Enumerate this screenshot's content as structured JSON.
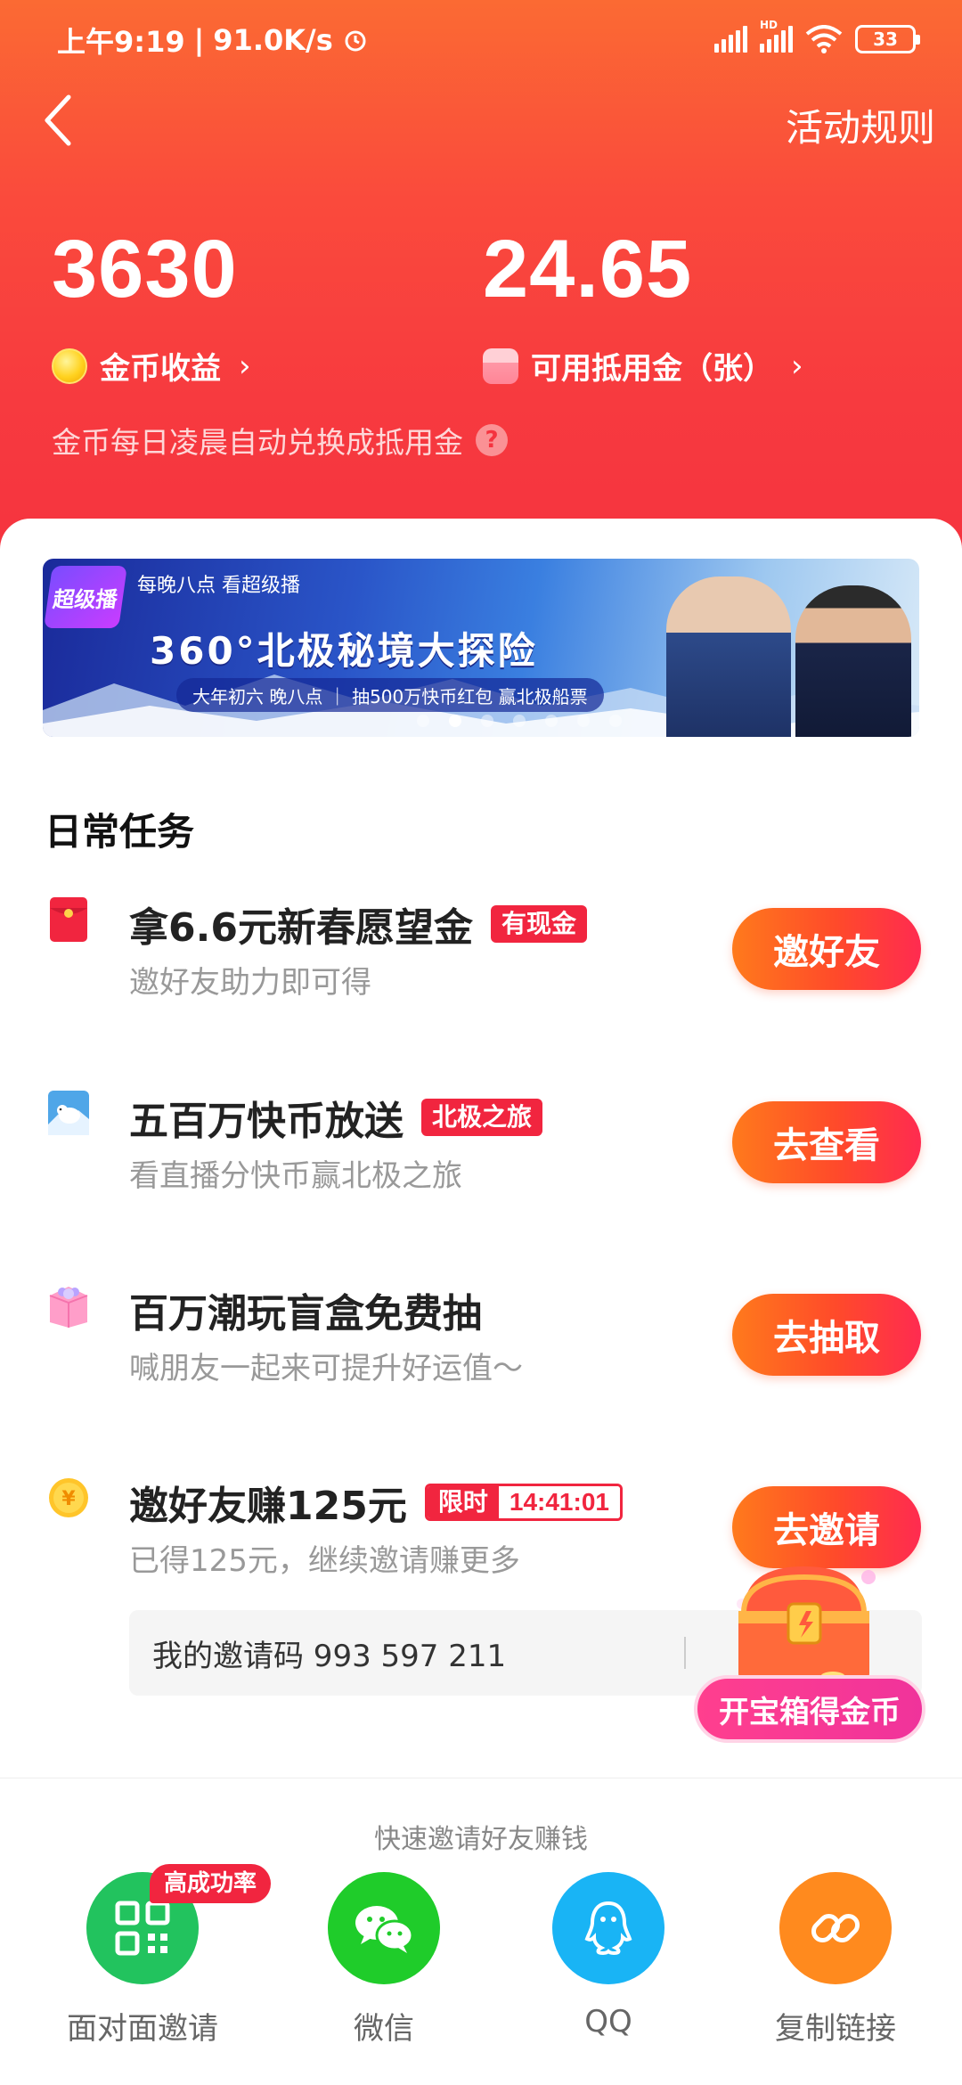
{
  "status_bar": {
    "time": "上午9:19",
    "speed": "91.0K/s",
    "hd_label": "HD",
    "battery": "33"
  },
  "nav": {
    "rules_label": "活动规则"
  },
  "stats": {
    "coins_value": "3630",
    "coins_label": "金币收益",
    "voucher_value": "24.65",
    "voucher_label": "可用抵用金（张）",
    "hint": "金币每日凌晨自动兑换成抵用金",
    "help_icon_text": "?"
  },
  "banner": {
    "logo_text": "超级播",
    "tag": "每晚八点 看超级播",
    "title": "360°北极秘境大探险",
    "subtitle": "大年初六 晚八点 ｜ 抽500万快币红包 赢北极船票",
    "dot_count": 7,
    "active_dot": 1
  },
  "section": {
    "title": "日常任务"
  },
  "tasks": [
    {
      "title": "拿6.6元新春愿望金",
      "tag": "有现金",
      "subtitle": "邀好友助力即可得",
      "button": "邀好友",
      "icon": "red-envelope-icon"
    },
    {
      "title": "五百万快币放送",
      "tag": "北极之旅",
      "subtitle": "看直播分快币赢北极之旅",
      "button": "去查看",
      "icon": "polar-bear-icon"
    },
    {
      "title": "百万潮玩盲盒免费抽",
      "tag": "",
      "subtitle": "喊朋友一起来可提升好运值～",
      "button": "去抽取",
      "icon": "blind-box-icon"
    },
    {
      "title": "邀好友赚125元",
      "tag_left": "限时",
      "tag_right": "14:41:01",
      "subtitle": "已得125元，继续邀请赚更多",
      "button": "去邀请",
      "icon": "yuan-coin-icon"
    }
  ],
  "invite_code": {
    "label": "我的邀请码 993 597 211"
  },
  "chest": {
    "label": "开宝箱得金币"
  },
  "share_sheet": {
    "title": "快速邀请好友赚钱",
    "hot_badge": "高成功率",
    "items": [
      {
        "label": "面对面邀请",
        "icon": "qr-code-icon",
        "color": "#22c35e"
      },
      {
        "label": "微信",
        "icon": "wechat-icon",
        "color": "#1fcc2a"
      },
      {
        "label": "QQ",
        "icon": "qq-icon",
        "color": "#19b4f5"
      },
      {
        "label": "复制链接",
        "icon": "link-icon",
        "color": "#ff8a1e"
      }
    ]
  },
  "colors": {
    "header_gradient_top": "#fb6a33",
    "header_gradient_bottom": "#f5333f",
    "accent_red": "#f1253f",
    "button_gradient_start": "#ff7a1c",
    "button_gradient_end": "#ff2b50"
  }
}
